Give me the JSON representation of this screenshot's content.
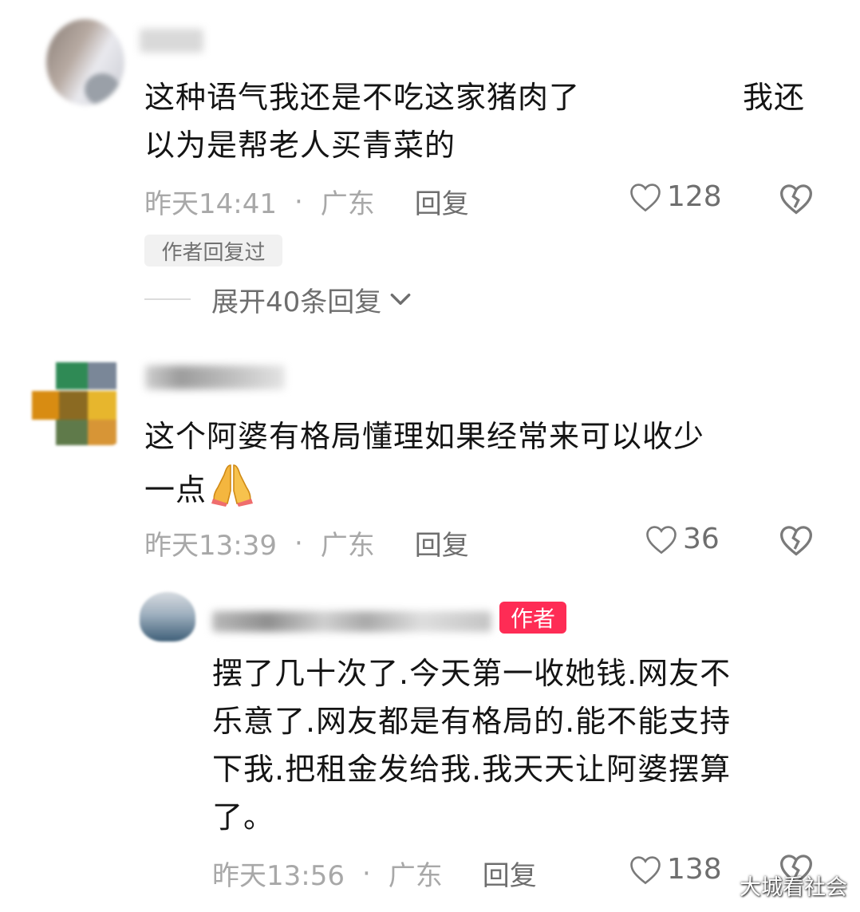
{
  "comments": [
    {
      "text_line1": "这种语气我还是不吃这家猪肉了",
      "text_line1_tail": "我还",
      "text_line2": "以为是帮老人买青菜的",
      "time": "昨天14:41",
      "dot": "·",
      "location": "广东",
      "reply_label": "回复",
      "likes": "128",
      "author_replied_tag": "作者回复过",
      "expand_label": "展开40条回复"
    },
    {
      "text_line1": "这个阿婆有格局懂理如果经常来可以收少",
      "text_line2": "一点",
      "emoji": "🙏",
      "time": "昨天13:39",
      "dot": "·",
      "location": "广东",
      "reply_label": "回复",
      "likes": "36"
    }
  ],
  "reply": {
    "author_badge": "作者",
    "lines": [
      "摆了几十次了.今天第一收她钱.网友不",
      "乐意了.网友都是有格局的.能不能支持",
      "下我.把租金发给我.我天天让阿婆摆算",
      "了。"
    ],
    "time": "昨天13:56",
    "dot": "·",
    "location": "广东",
    "reply_label": "回复",
    "likes": "138"
  },
  "watermark": "大城看社会",
  "icons": {
    "like": "heart-outline-icon",
    "dislike": "broken-heart-icon",
    "expand": "chevron-down-icon"
  },
  "colors": {
    "meta_gray": "#a8a8a8",
    "action_gray": "#6e6e6e",
    "author_badge_red": "#fe2c55"
  }
}
